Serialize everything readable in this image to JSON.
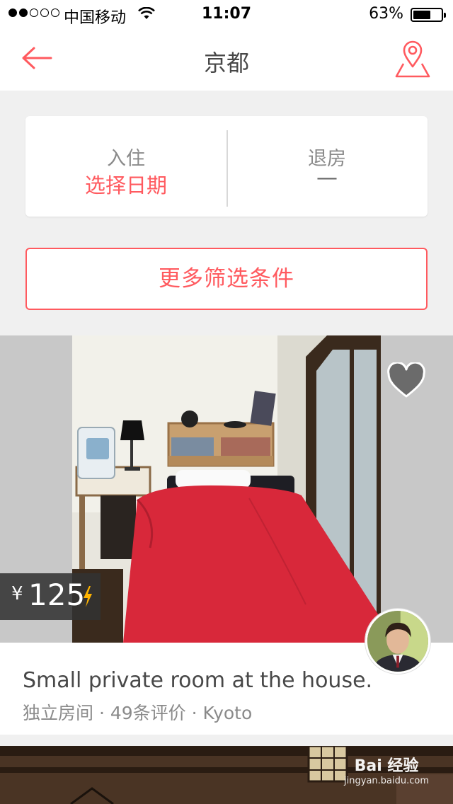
{
  "status_bar": {
    "carrier": "中国移动",
    "time": "11:07",
    "battery_percent": "63%",
    "battery_level": 0.63
  },
  "nav": {
    "title": "京都",
    "back_icon": "back-arrow-icon",
    "map_icon": "map-pin-icon"
  },
  "dates": {
    "checkin_label": "入住",
    "checkin_value": "选择日期",
    "checkout_label": "退房",
    "checkout_value": "—"
  },
  "filter": {
    "label": "更多筛选条件"
  },
  "listings": [
    {
      "title": "Small private room at the house.",
      "subtitle": "独立房间 · 49条评价 · Kyoto",
      "currency": "¥",
      "price": "125",
      "instant_book_icon": "lightning-icon",
      "favorite_icon": "heart-icon"
    }
  ],
  "watermark": {
    "brand": "Bai 经验",
    "url": "jingyan.baidu.com"
  },
  "colors": {
    "accent": "#ff5a5f",
    "background": "#f0f0f0",
    "bolt": "#ffb400"
  }
}
